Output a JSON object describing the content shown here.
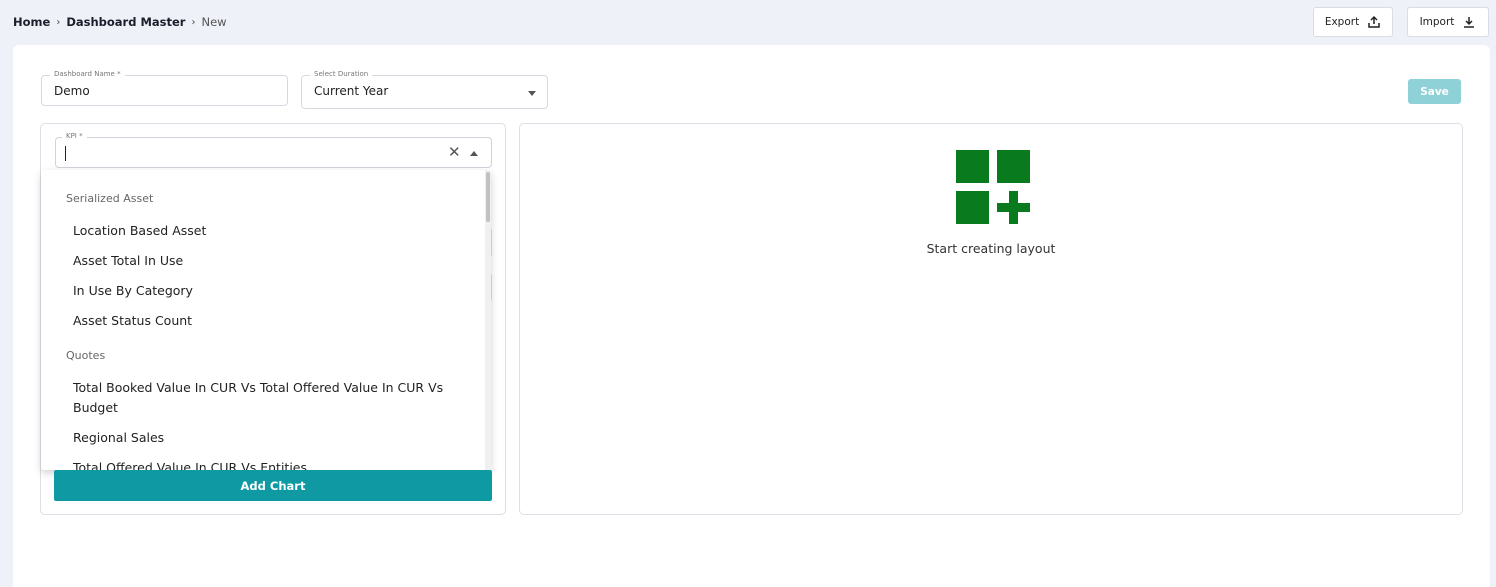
{
  "breadcrumb": {
    "home": "Home",
    "section": "Dashboard Master",
    "current": "New",
    "separator": "›"
  },
  "toolbar": {
    "export_label": "Export",
    "import_label": "Import"
  },
  "form": {
    "dashboard_name": {
      "label": "Dashboard Name *",
      "value": "Demo"
    },
    "duration": {
      "label": "Select Duration",
      "value": "Current Year"
    },
    "save_label": "Save"
  },
  "kpi": {
    "label": "KPI *",
    "value": "",
    "clear_icon": "close-icon",
    "open": true
  },
  "dropdown": {
    "groups": [
      {
        "name": "Serialized Asset",
        "items": [
          "Location Based Asset",
          "Asset Total In Use",
          "In Use By Category",
          "Asset Status Count"
        ]
      },
      {
        "name": "Quotes",
        "items": [
          "Total Booked Value In CUR Vs Total Offered Value In CUR Vs Budget",
          "Regional Sales",
          "Total Offered Value In CUR Vs Entities"
        ]
      }
    ]
  },
  "add_chart_label": "Add Chart",
  "canvas": {
    "empty_text": "Start creating layout",
    "icon": "add-layout-icon"
  },
  "colors": {
    "accent": "#0f9aa3",
    "save_disabled": "#8ed1d6",
    "layout_icon": "#0a7a1e",
    "background": "#eef1f8"
  }
}
